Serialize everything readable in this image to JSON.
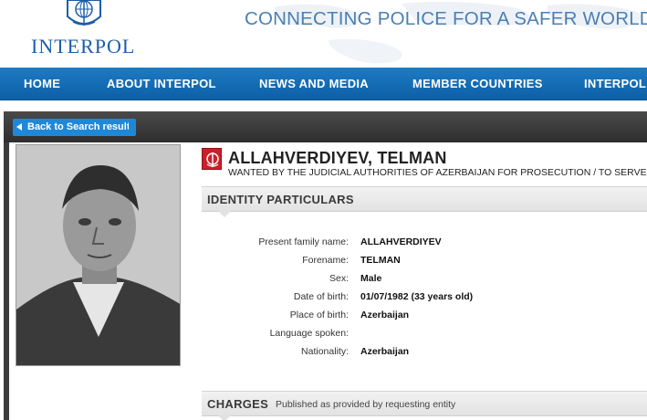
{
  "header": {
    "logo_text": "INTERPOL",
    "tagline": "CONNECTING POLICE FOR A SAFER WORLD"
  },
  "nav": {
    "items": [
      {
        "label": "HOME"
      },
      {
        "label": "ABOUT INTERPOL"
      },
      {
        "label": "NEWS AND MEDIA"
      },
      {
        "label": "MEMBER COUNTRIES"
      },
      {
        "label": "INTERPOL"
      }
    ]
  },
  "back_button": {
    "label": "Back to Search result"
  },
  "notice": {
    "name": "ALLAHVERDIYEV, TELMAN",
    "wanted_line": "WANTED BY THE JUDICIAL AUTHORITIES OF AZERBAIJAN FOR PROSECUTION / TO SERVE"
  },
  "identity": {
    "title": "IDENTITY PARTICULARS",
    "fields": [
      {
        "label": "Present family name:",
        "value": "ALLAHVERDIYEV"
      },
      {
        "label": "Forename:",
        "value": "TELMAN"
      },
      {
        "label": "Sex:",
        "value": "Male"
      },
      {
        "label": "Date of birth:",
        "value": "01/07/1982 (33 years old)"
      },
      {
        "label": "Place of birth:",
        "value": "Azerbaijan"
      },
      {
        "label": "Language spoken:",
        "value": ""
      },
      {
        "label": "Nationality:",
        "value": "Azerbaijan"
      }
    ]
  },
  "charges": {
    "title": "CHARGES",
    "note": "Published as provided by requesting entity"
  },
  "colors": {
    "brand_blue": "#1a5ea8",
    "nav_blue": "#0d5fa6",
    "button_blue": "#1e88d8",
    "notice_red": "#c8202c",
    "band_dark": "#3b3b3b"
  },
  "icons": {
    "logo": "interpol-globe-icon",
    "badge": "red-notice-icon",
    "back": "arrow-left-icon"
  }
}
